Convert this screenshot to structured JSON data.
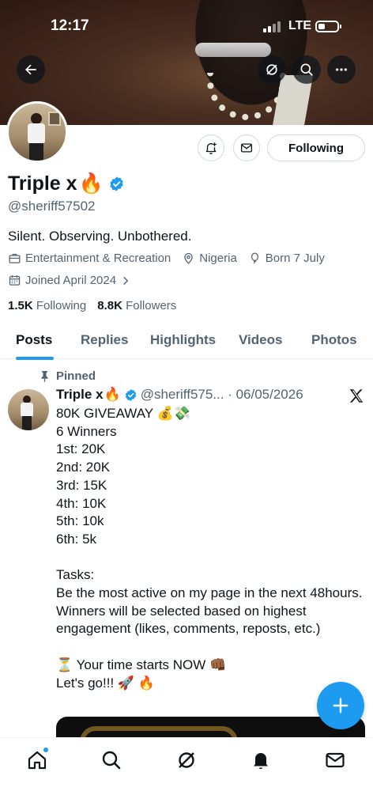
{
  "status_bar": {
    "time": "12:17",
    "network": "LTE"
  },
  "header": {
    "back_icon": "back-arrow-icon",
    "grok_icon": "grok-icon",
    "search_icon": "search-icon",
    "more_icon": "more-icon"
  },
  "profile": {
    "name": "Triple x",
    "name_emoji": "🔥",
    "handle": "@sheriff57502",
    "bio": "Silent. Observing. Unbothered.",
    "category": "Entertainment & Recreation",
    "location": "Nigeria",
    "birthday": "Born 7 July",
    "joined": "Joined April 2024",
    "following_count": "1.5K",
    "following_label": "Following",
    "followers_count": "8.8K",
    "followers_label": "Followers",
    "follow_button": "Following"
  },
  "tabs": [
    "Posts",
    "Replies",
    "Highlights",
    "Videos",
    "Photos"
  ],
  "post": {
    "pinned_label": "Pinned",
    "author": "Triple x",
    "author_emoji": "🔥",
    "handle_date": "@sheriff575... · 06/05/2026",
    "text": "80K GIVEAWAY 💰💸\n6 Winners\n1st:  20K\n2nd: 20K\n3rd: 15K\n4th: 10K\n5th: 10k\n6th: 5k\n\nTasks:\nBe the most active on my page in the next 48hours.\nWinners will be selected based on highest engagement (likes, comments, reposts, etc.)\n\n⏳ Your time starts NOW 👊🏾\nLet's go!!! 🚀 🔥"
  },
  "colors": {
    "accent": "#1d9bf0",
    "text": "#0f1419",
    "secondary": "#536471"
  }
}
